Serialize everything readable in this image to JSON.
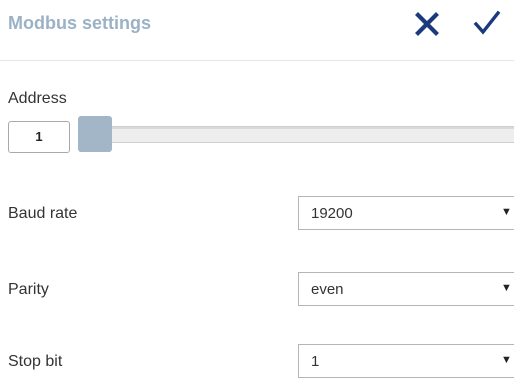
{
  "header": {
    "title": "Modbus settings",
    "close_icon": "close-icon",
    "confirm_icon": "checkmark-icon",
    "icon_color": "#1b3a7e",
    "title_color": "#9bb1c6"
  },
  "address": {
    "label": "Address",
    "value": "1",
    "slider_thumb_color": "#a3b6c7"
  },
  "baud_rate": {
    "label": "Baud rate",
    "selected": "19200",
    "caret": "▼"
  },
  "parity": {
    "label": "Parity",
    "selected": "even",
    "caret": "▼"
  },
  "stop_bit": {
    "label": "Stop bit",
    "selected": "1",
    "caret": "▼"
  }
}
